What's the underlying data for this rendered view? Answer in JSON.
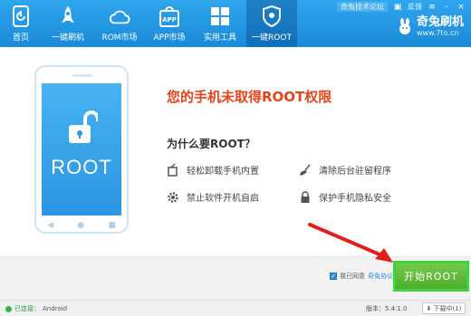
{
  "topbar": {
    "forum_label": "奇兔技术论坛",
    "feedback_label": "反馈",
    "nav": [
      {
        "label": "首页",
        "icon": "home-icon"
      },
      {
        "label": "一键刷机",
        "icon": "rocket-icon"
      },
      {
        "label": "ROM市场",
        "icon": "cloud-icon"
      },
      {
        "label": "APP市场",
        "icon": "app-bag-icon"
      },
      {
        "label": "实用工具",
        "icon": "grid-icon"
      },
      {
        "label": "一键ROOT",
        "icon": "shield-icon"
      }
    ],
    "active_tab": "一键ROOT",
    "brand_name": "奇兔刷机",
    "brand_url": "www.7to.cn"
  },
  "main": {
    "phone_screen_text": "ROOT",
    "headline": "您的手机未取得ROOT权限",
    "question": "为什么要ROOT？",
    "features": [
      {
        "label": "轻松卸载手机内置",
        "icon": "uninstall-icon"
      },
      {
        "label": "清除后台驻留程序",
        "icon": "broom-icon"
      },
      {
        "label": "禁止软件开机自启",
        "icon": "gear-icon"
      },
      {
        "label": "保护手机隐私安全",
        "icon": "lock-icon"
      }
    ]
  },
  "action": {
    "agree_prefix": "我已同意",
    "agree_terms": "奇兔协议",
    "start_button": "开始ROOT"
  },
  "statusbar": {
    "connection_status": "已连接：",
    "device": "Android",
    "version_label": "版本：",
    "version": "5.4.1.0",
    "download_label": "下载中(1)"
  },
  "colors": {
    "topbar": "#1e90db",
    "headline": "#e8421a",
    "start_button": "#4fae2a",
    "highlight_border": "#3fd33f",
    "arrow": "#e0201c"
  }
}
